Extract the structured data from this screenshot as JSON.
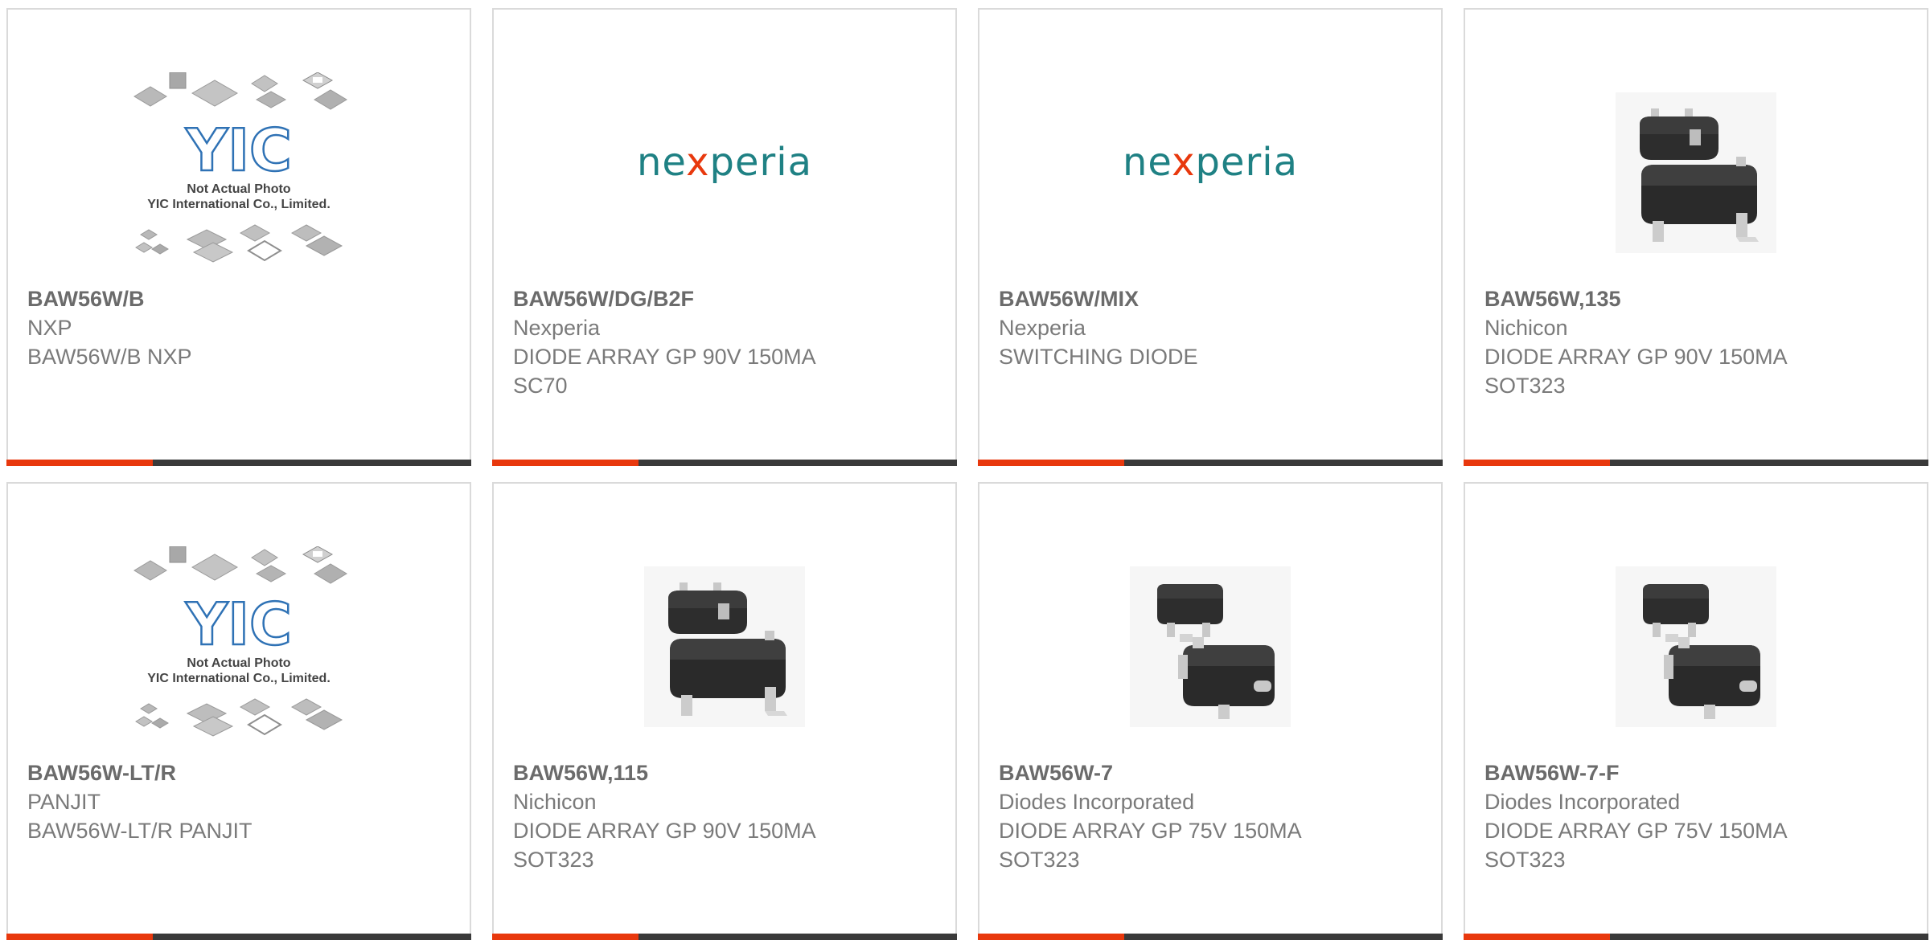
{
  "colors": {
    "accent": "#e8380d",
    "bar": "#3a3a3a",
    "border": "#dadada",
    "nexperia_teal": "#1f8184"
  },
  "nexperia_logo": {
    "part1": "ne",
    "x": "x",
    "part2": "peria"
  },
  "yic_placeholder": {
    "logo": "YIC",
    "line1": "Not Actual Photo",
    "line2": "YIC International Co., Limited."
  },
  "products": [
    {
      "part_number": "BAW56W/B",
      "manufacturer": "NXP",
      "description": "BAW56W/B NXP",
      "image": "yic-placeholder"
    },
    {
      "part_number": "BAW56W/DG/B2F",
      "manufacturer": "Nexperia",
      "description": "DIODE ARRAY GP 90V 150MA\nSC70",
      "image": "nexperia-logo"
    },
    {
      "part_number": "BAW56W/MIX",
      "manufacturer": "Nexperia",
      "description": "SWITCHING DIODE",
      "image": "nexperia-logo"
    },
    {
      "part_number": "BAW56W,135",
      "manufacturer": "Nichicon",
      "description": "DIODE ARRAY GP 90V 150MA\nSOT323",
      "image": "sot323-chip"
    },
    {
      "part_number": "BAW56W-LT/R",
      "manufacturer": "PANJIT",
      "description": "BAW56W-LT/R PANJIT",
      "image": "yic-placeholder"
    },
    {
      "part_number": "BAW56W,115",
      "manufacturer": "Nichicon",
      "description": "DIODE ARRAY GP 90V 150MA\nSOT323",
      "image": "sot323-chip"
    },
    {
      "part_number": "BAW56W-7",
      "manufacturer": "Diodes Incorporated",
      "description": "DIODE ARRAY GP 75V 150MA\nSOT323",
      "image": "sot323-chip-rotated"
    },
    {
      "part_number": "BAW56W-7-F",
      "manufacturer": "Diodes Incorporated",
      "description": "DIODE ARRAY GP 75V 150MA\nSOT323",
      "image": "sot323-chip-rotated"
    }
  ]
}
